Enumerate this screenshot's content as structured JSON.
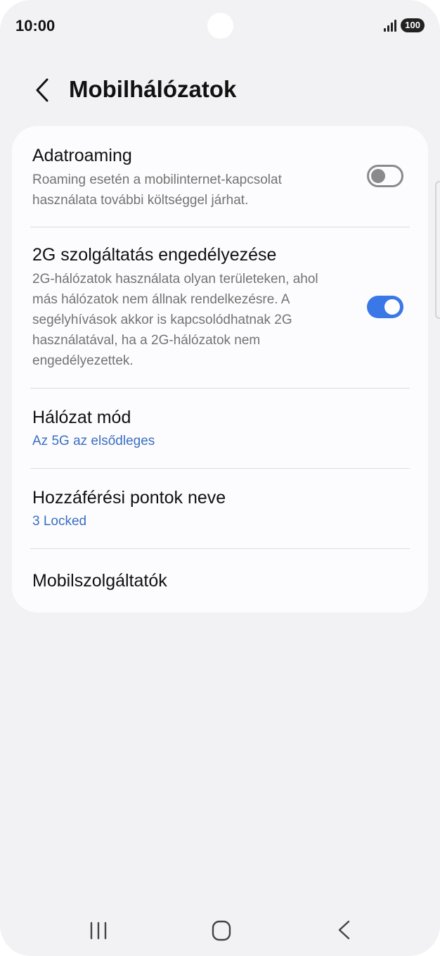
{
  "status_bar": {
    "time": "10:00",
    "battery": "100",
    "icons": [
      "signal-icon",
      "battery-icon"
    ]
  },
  "header": {
    "title": "Mobilhálózatok",
    "back_icon": "chevron-left-icon"
  },
  "settings": {
    "data_roaming": {
      "title": "Adatroaming",
      "description": "Roaming esetén a mobilinternet-kapcsolat használata további költséggel járhat.",
      "enabled": false
    },
    "allow_2g": {
      "title": "2G szolgáltatás engedélyezése",
      "description": "2G-hálózatok használata olyan területeken, ahol más hálózatok nem állnak rendelkezésre. A segélyhívások akkor is kapcsolódhatnak 2G használatával, ha a 2G-hálózatok nem engedélyezettek.",
      "enabled": true
    },
    "network_mode": {
      "title": "Hálózat mód",
      "value": "Az 5G az elsődleges"
    },
    "access_point_names": {
      "title": "Hozzáférési pontok neve",
      "value": "3 Locked"
    },
    "network_operators": {
      "title": "Mobilszolgáltatók"
    }
  },
  "navigation_bar": {
    "icons": [
      "recent-apps-icon",
      "home-icon",
      "back-icon"
    ]
  },
  "colors": {
    "accent": "#3b78e7",
    "link": "#3a6fc4",
    "background": "#f2f2f5",
    "card": "#fcfcfe"
  }
}
